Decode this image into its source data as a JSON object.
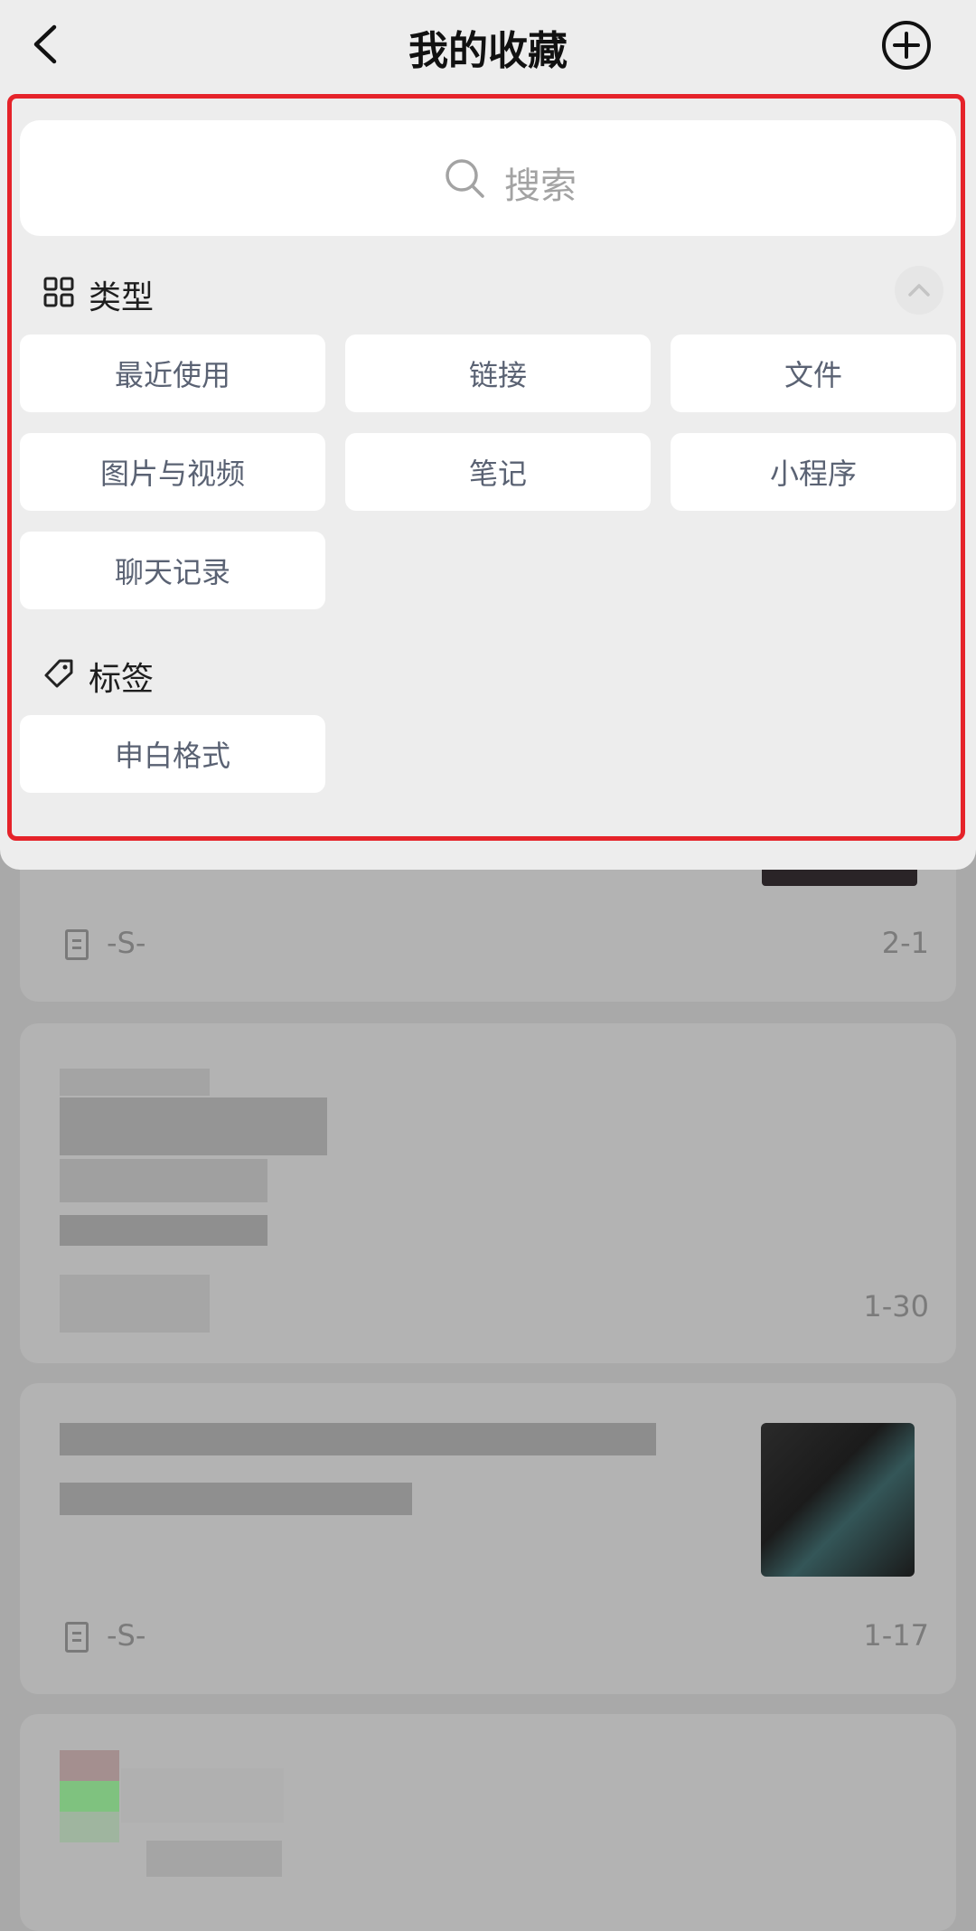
{
  "topbar": {
    "title": "我的收藏",
    "back_icon": "chevron-left-icon",
    "add_icon": "plus-circle-icon"
  },
  "search": {
    "placeholder": "搜索"
  },
  "types": {
    "heading": "类型",
    "items": [
      "最近使用",
      "链接",
      "文件",
      "图片与视频",
      "笔记",
      "小程序",
      "聊天记录"
    ]
  },
  "tags": {
    "heading": "标签",
    "items": [
      "申白格式"
    ]
  },
  "background_list": {
    "items": [
      {
        "source": "-S-",
        "date": "2-1"
      },
      {
        "source": "",
        "date": "1-30"
      },
      {
        "source": "-S-",
        "date": "1-17"
      }
    ]
  },
  "colors": {
    "highlight_border": "#e5232a",
    "panel_bg": "#ededed",
    "chip_text": "#5a6273"
  }
}
